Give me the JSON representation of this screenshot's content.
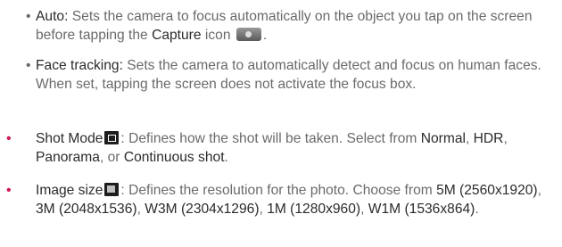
{
  "auto": {
    "term": "Auto:",
    "text1": " Sets the camera to focus automatically on the object you tap on the screen before tapping the ",
    "capture": "Capture",
    "text2": " icon ",
    "end": "."
  },
  "face": {
    "term": "Face tracking:",
    "text": " Sets the camera to automatically detect and focus on human faces. When set, tapping the screen does not activate the focus box."
  },
  "shot": {
    "term": "Shot Mode",
    "text1": ": Defines how the shot will be taken. Select from ",
    "opt1": "Normal",
    "sep1": ", ",
    "opt2": "HDR",
    "sep2": ", ",
    "opt3": "Panorama",
    "sep3": ", or ",
    "opt4": "Continuous shot",
    "end": "."
  },
  "size": {
    "term": "Image size",
    "text1": ": Defines the resolution for the photo. Choose from ",
    "opt1": "5M (2560x1920)",
    "sep1": ", ",
    "opt2": "3M (2048x1536)",
    "sep2": ", ",
    "opt3": "W3M (2304x1296)",
    "sep3": ", ",
    "opt4": "1M (1280x960)",
    "sep4": ", ",
    "opt5": "W1M (1536x864)",
    "end": "."
  },
  "icons": {
    "capture": "camera-capture-icon",
    "shot_mode": "shot-mode-icon",
    "image_size": "image-size-icon"
  },
  "colors": {
    "text": "#6a6a6a",
    "emphasis": "#2b2b2b",
    "bullet_accent": "#d4145a"
  }
}
